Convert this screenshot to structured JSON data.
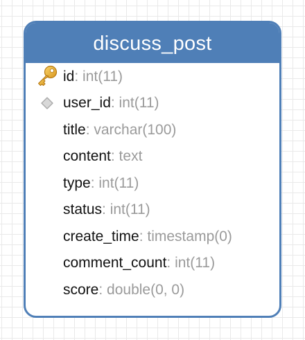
{
  "table": {
    "name": "discuss_post",
    "header_color": "#4f7fb7",
    "columns": [
      {
        "name": "id",
        "type": ": int(11)",
        "key": "primary"
      },
      {
        "name": "user_id",
        "type": ": int(11)",
        "key": "index"
      },
      {
        "name": "title",
        "type": ": varchar(100)",
        "key": "none"
      },
      {
        "name": "content",
        "type": ": text",
        "key": "none"
      },
      {
        "name": "type",
        "type": ": int(11)",
        "key": "none"
      },
      {
        "name": "status",
        "type": ": int(11)",
        "key": "none"
      },
      {
        "name": "create_time",
        "type": ": timestamp(0)",
        "key": "none"
      },
      {
        "name": "comment_count",
        "type": ": int(11)",
        "key": "none"
      },
      {
        "name": "score",
        "type": ": double(0, 0)",
        "key": "none"
      }
    ]
  }
}
